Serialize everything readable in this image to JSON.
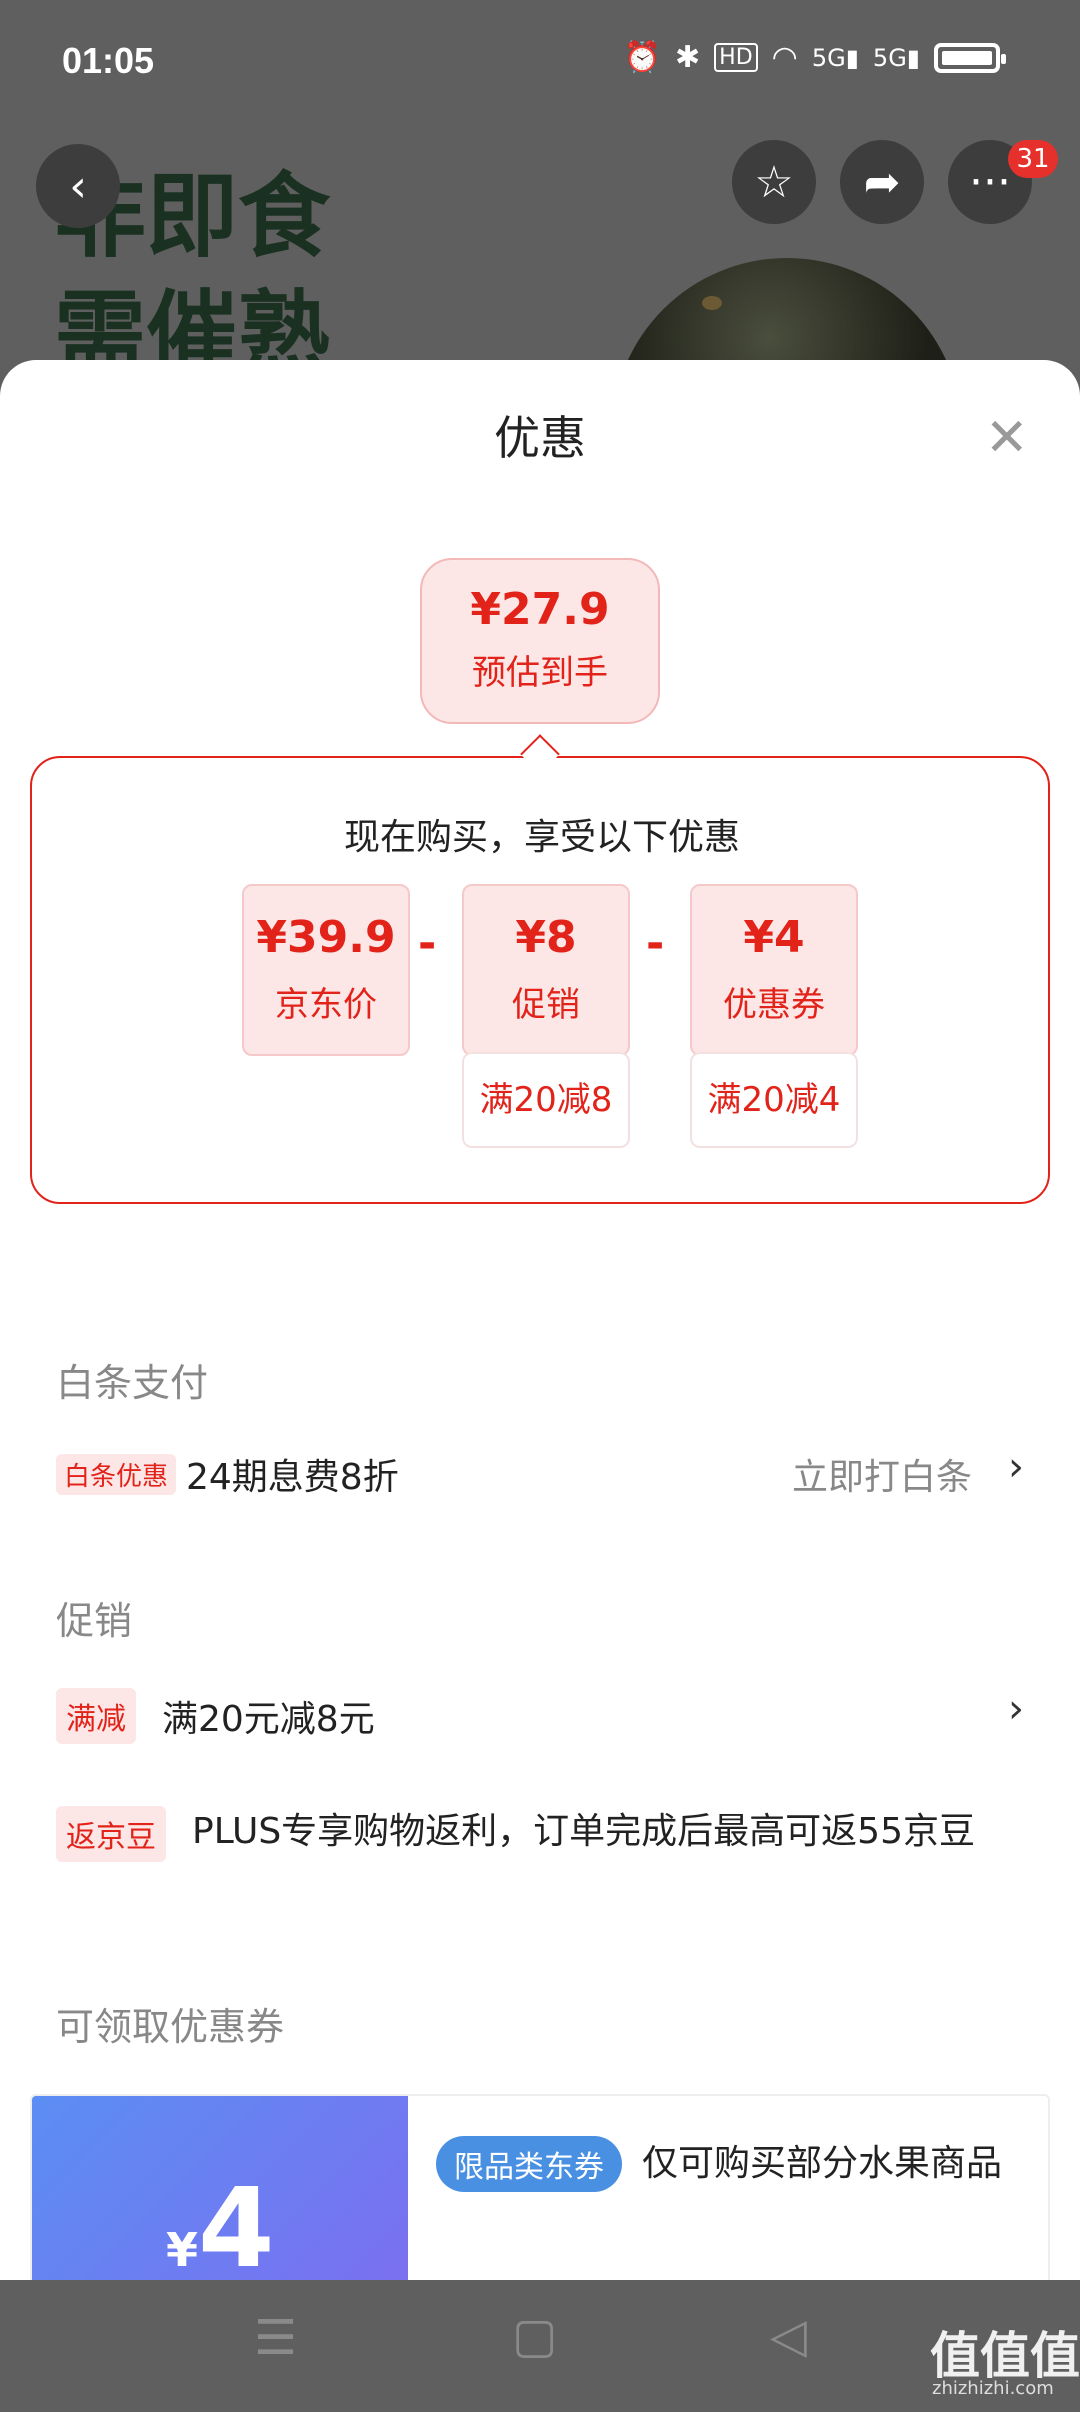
{
  "status": {
    "time": "01:05",
    "icons": [
      "alarm-icon",
      "bluetooth-icon",
      "hd-icon",
      "wifi-icon",
      "5g-signal-icon",
      "5g-signal-icon",
      "battery-icon"
    ]
  },
  "background": {
    "headline_line1": "非即食",
    "headline_line2": "需催熟",
    "notification_count": "31"
  },
  "sheet": {
    "title": "优惠",
    "estimate": {
      "price": "¥27.9",
      "label": "预估到手"
    },
    "breakdown": {
      "title": "现在购买，享受以下优惠",
      "items": [
        {
          "value": "¥39.9",
          "label": "京东价",
          "note": ""
        },
        {
          "value": "¥8",
          "label": "促销",
          "note": "满20减8"
        },
        {
          "value": "¥4",
          "label": "优惠券",
          "note": "满20减4"
        }
      ],
      "operator": "-"
    },
    "baitiao": {
      "section": "白条支付",
      "tag": "白条优惠",
      "text": "24期息费8折",
      "action": "立即打白条"
    },
    "promo": {
      "section": "促销",
      "items": [
        {
          "tag": "满减",
          "text": "满20元减8元"
        },
        {
          "tag": "返京豆",
          "text": "PLUS专享购物返利，订单完成后最高可返55京豆"
        }
      ]
    },
    "coupons": {
      "section": "可领取优惠券",
      "currency": "¥",
      "amount": "4",
      "tag": "限品类东券",
      "desc": "仅可购买部分水果商品"
    }
  },
  "watermark": {
    "title": "值值值",
    "sub": "zhizhizhi.com"
  },
  "colors": {
    "accent": "#e2231a",
    "tag_bg": "#fde6e6",
    "coupon_blue": "#5b8ef3"
  }
}
